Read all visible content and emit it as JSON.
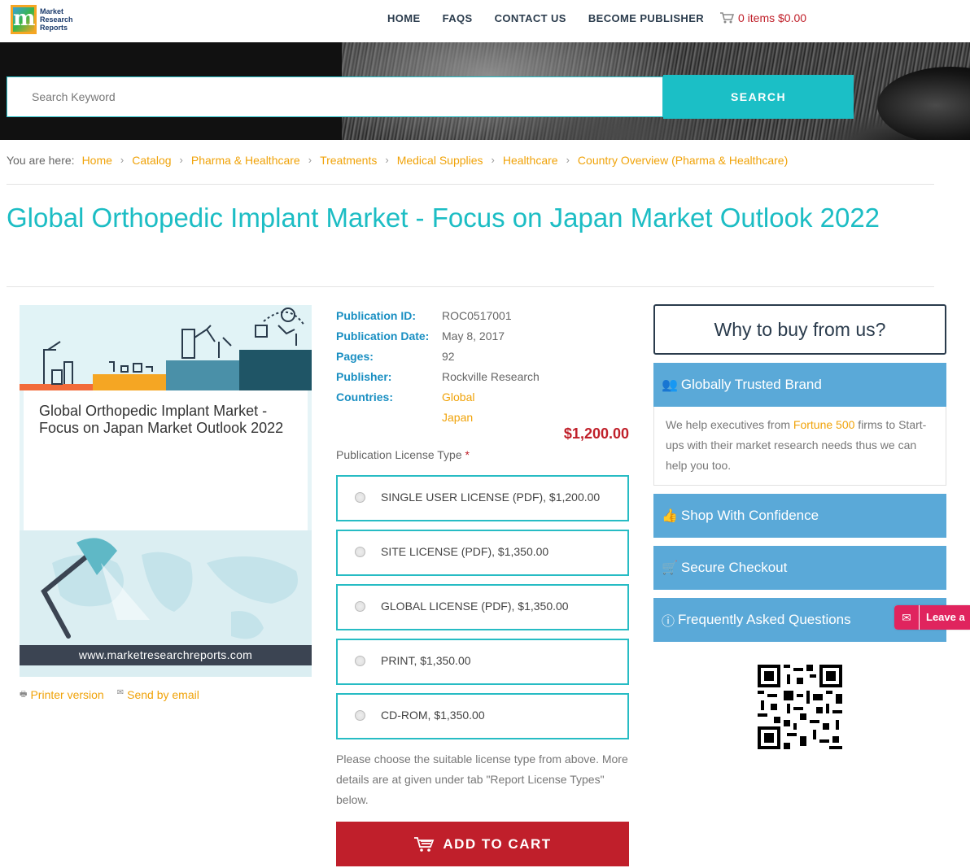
{
  "header": {
    "logo_text": [
      "Market",
      "Research",
      "Reports"
    ],
    "logo_mark": "m",
    "nav": [
      "HOME",
      "FAQS",
      "CONTACT US",
      "BECOME PUBLISHER"
    ],
    "cart": "0 items $0.00"
  },
  "search": {
    "placeholder": "Search Keyword",
    "button": "SEARCH"
  },
  "breadcrumb": {
    "prefix": "You are here:",
    "items": [
      "Home",
      "Catalog",
      "Pharma & Healthcare",
      "Treatments",
      "Medical Supplies",
      "Healthcare",
      "Country Overview (Pharma & Healthcare)"
    ]
  },
  "page_title": "Global Orthopedic Implant Market - Focus on Japan Market Outlook 2022",
  "cover": {
    "title": "Global Orthopedic Implant Market - Focus on Japan Market Outlook 2022",
    "url": "www.marketresearchreports.com"
  },
  "links": {
    "printer": "Printer version",
    "email": "Send by email"
  },
  "details": {
    "publication_id_label": "Publication ID:",
    "publication_id": "ROC0517001",
    "publication_date_label": "Publication Date:",
    "publication_date": "May 8, 2017",
    "pages_label": "Pages:",
    "pages": "92",
    "publisher_label": "Publisher:",
    "publisher": "Rockville Research",
    "countries_label": "Countries:",
    "countries": [
      "Global",
      "Japan"
    ]
  },
  "price": "$1,200.00",
  "license": {
    "label": "Publication License Type",
    "required_mark": "*",
    "options": [
      "SINGLE USER LICENSE (PDF), $1,200.00",
      "SITE LICENSE (PDF), $1,350.00",
      "GLOBAL LICENSE (PDF), $1,350.00",
      "PRINT, $1,350.00",
      "CD-ROM, $1,350.00"
    ],
    "note": "Please choose the suitable license type from above. More details are at given under tab \"Report License Types\" below."
  },
  "add_to_cart": "ADD TO CART",
  "sidebar": {
    "why_title": "Why to buy from us?",
    "trusted_title": "Globally Trusted Brand",
    "trusted_body_pre": "We help executives from ",
    "trusted_body_hl": "Fortune 500",
    "trusted_body_post": " firms to Start-ups with their market research needs thus we can help you too.",
    "shop_title": "Shop With Confidence",
    "secure_title": "Secure Checkout",
    "faq_title": "Frequently Asked Questions"
  },
  "leave_message": "Leave a",
  "colors": {
    "accent_teal": "#1bbfc6",
    "link_orange": "#f0a30a",
    "price_red": "#c0202a",
    "sidebar_blue": "#5aa9d8"
  }
}
